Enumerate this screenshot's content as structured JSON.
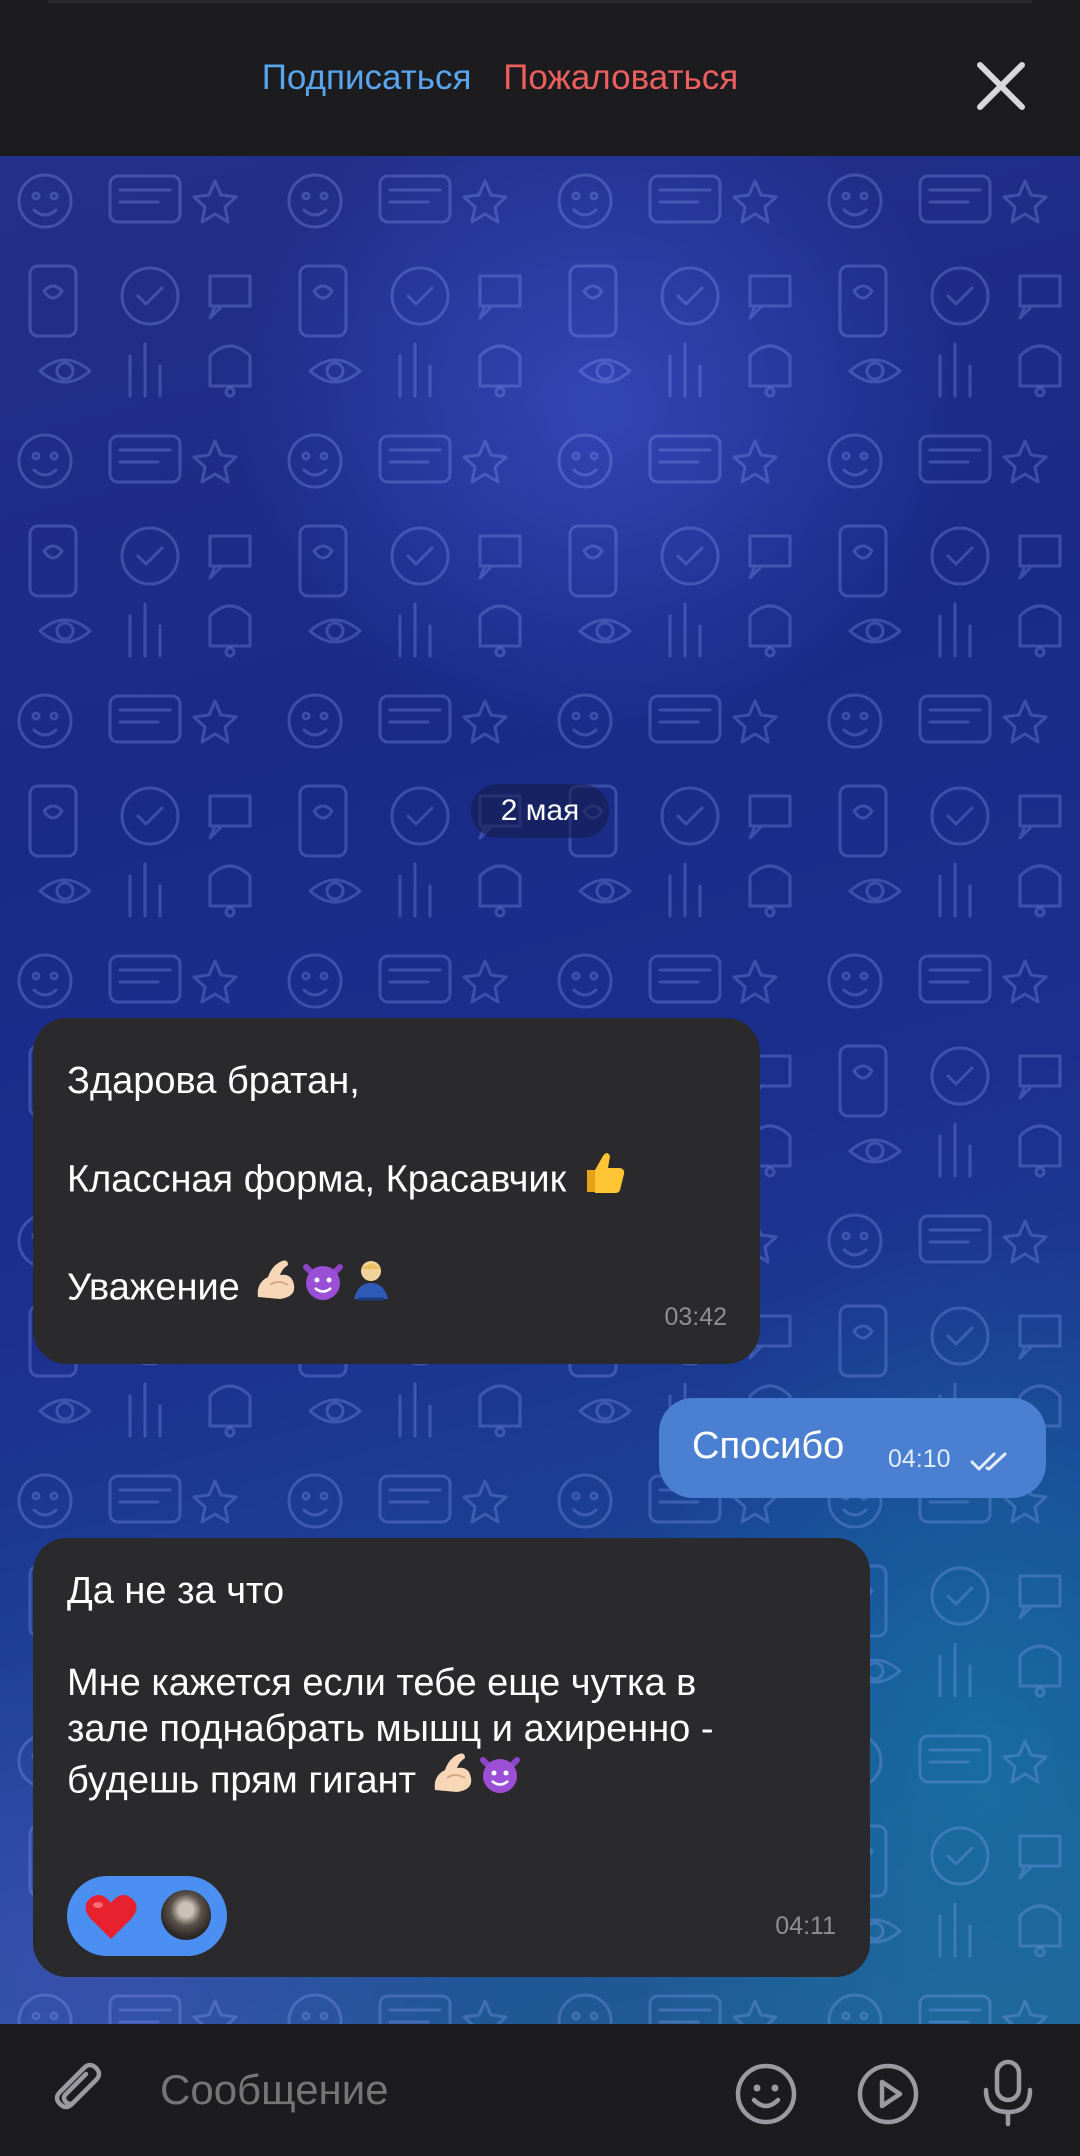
{
  "header": {
    "subscribe_label": "Подписаться",
    "report_label": "Пожаловаться",
    "close_icon": "close-icon"
  },
  "chat": {
    "date_label": "2 мая",
    "messages": [
      {
        "direction": "incoming",
        "text": "Здарова братан,\n\nКлассная форма, Красавчик",
        "line3": "Уважение",
        "emojis": [
          "thumbs-up",
          "flexed-biceps",
          "smiling-devil",
          "bowing-person"
        ],
        "time": "03:42"
      },
      {
        "direction": "outgoing",
        "text": "Спосибо",
        "time": "04:10",
        "status_icon": "double-check-icon"
      },
      {
        "direction": "incoming",
        "text": "Да не за что\n\nМне кажется если тебе еще чутка в\nзале поднабрать мышц и ахиренно -\nбудешь прям гигант",
        "emojis": [
          "flexed-biceps",
          "smiling-devil"
        ],
        "reaction": "red-heart",
        "time": "04:11"
      }
    ]
  },
  "composer": {
    "placeholder": "Сообщение",
    "icons": [
      "paperclip-icon",
      "emoji-icon",
      "video-message-icon",
      "microphone-icon"
    ]
  },
  "colors": {
    "subscribe": "#5aa6ee",
    "report": "#ee5f5f",
    "incoming_bubble": "#2a2a2d",
    "outgoing_bubble": "#4b7fd1",
    "reaction_pill": "#4b8ff2",
    "bar": "#1c1c1e"
  }
}
